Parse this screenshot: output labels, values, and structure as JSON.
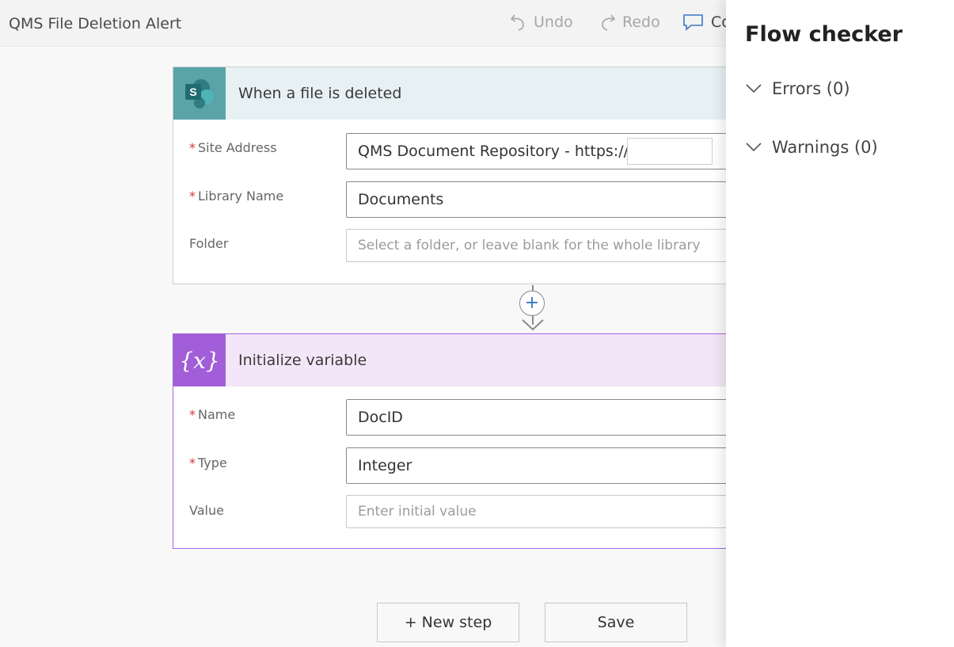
{
  "header": {
    "flow_title": "QMS File Deletion Alert",
    "undo_label": "Undo",
    "redo_label": "Redo",
    "comments_label": "Co"
  },
  "trigger_card": {
    "title": "When a file is deleted",
    "icon_letter": "S",
    "fields": {
      "site_address": {
        "label": "Site Address",
        "required": "*",
        "value": "QMS Document Repository - https://"
      },
      "library_name": {
        "label": "Library Name",
        "required": "*",
        "value": "Documents"
      },
      "folder": {
        "label": "Folder",
        "placeholder": "Select a folder, or leave blank for the whole library"
      }
    }
  },
  "variable_card": {
    "title": "Initialize variable",
    "icon_text": "{x}",
    "fields": {
      "name": {
        "label": "Name",
        "required": "*",
        "value": "DocID"
      },
      "type": {
        "label": "Type",
        "required": "*",
        "value": "Integer"
      },
      "value": {
        "label": "Value",
        "placeholder": "Enter initial value"
      }
    }
  },
  "connector": {
    "plus_label": "+"
  },
  "actions": {
    "new_step_label": "+ New step",
    "save_label": "Save"
  },
  "flow_checker": {
    "title": "Flow checker",
    "errors_label": "Errors (0)",
    "warnings_label": "Warnings (0)"
  },
  "colors": {
    "trigger_accent": "#5aa4a7",
    "variable_accent": "#a15ed8",
    "variable_border": "#a566e0",
    "required_marker": "#d13438",
    "link_blue": "#3a77c4"
  },
  "icons": [
    "undo-icon",
    "redo-icon",
    "comment-icon",
    "sharepoint-icon",
    "variable-icon",
    "add-step-icon",
    "arrow-down-icon",
    "chevron-down-icon"
  ]
}
